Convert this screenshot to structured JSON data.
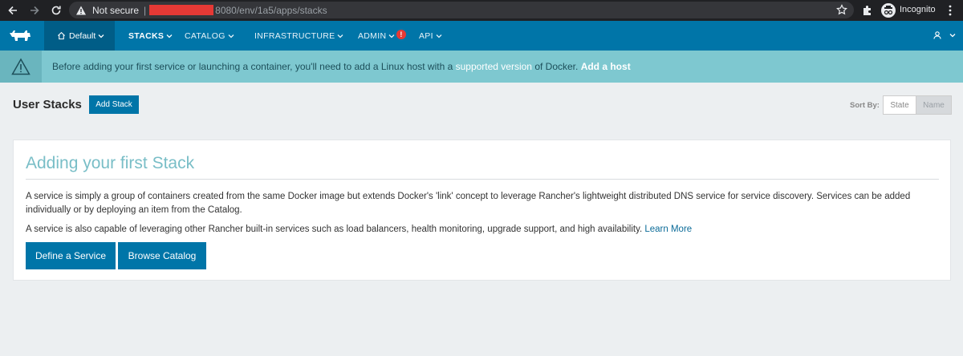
{
  "browser": {
    "security_label": "Not secure",
    "separator": "|",
    "url_visible": "8080/env/1a5/apps/stacks",
    "profile_label": "Incognito"
  },
  "header": {
    "environment_label": "Default",
    "menu": [
      {
        "label": "STACKS",
        "active": true
      },
      {
        "label": "CATALOG"
      },
      {
        "label": "INFRASTRUCTURE"
      },
      {
        "label": "ADMIN",
        "badge": "!"
      },
      {
        "label": "API"
      }
    ]
  },
  "banner": {
    "text_before": "Before adding your first service or launching a container, you'll need to add a Linux host with a ",
    "link_supported": "supported version",
    "text_after": " of Docker. ",
    "link_add_host": "Add a host"
  },
  "page": {
    "title": "User Stacks",
    "add_stack_label": "Add Stack",
    "sort_by_label": "Sort By:",
    "sort_options": [
      "State",
      "Name"
    ],
    "sort_selected": "Name"
  },
  "card": {
    "title": "Adding your first Stack",
    "paragraph1": "A service is simply a group of containers created from the same Docker image but extends Docker's 'link' concept to leverage Rancher's lightweight distributed DNS service for service discovery. Services can be added individually or by deploying an item from the Catalog.",
    "paragraph2": "A service is also capable of leveraging other Rancher built-in services such as load balancers, health monitoring, upgrade support, and high availability. ",
    "learn_more": "Learn More",
    "define_service_label": "Define a Service",
    "browse_catalog_label": "Browse Catalog"
  },
  "colors": {
    "brand_blue": "#0075a8",
    "banner_bg": "#7ec8d0",
    "card_title": "#79bec7",
    "badge_red": "#e53935"
  }
}
